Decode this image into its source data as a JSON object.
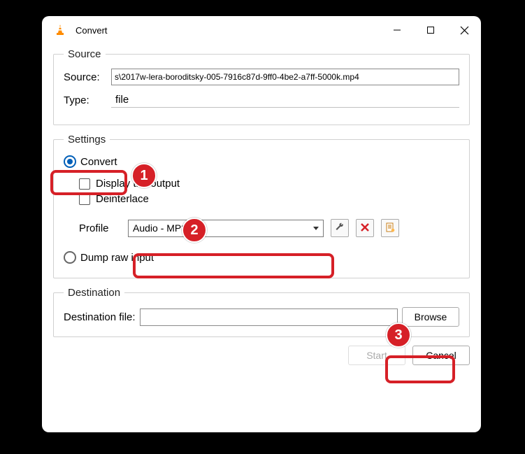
{
  "window": {
    "title": "Convert"
  },
  "source": {
    "legend": "Source",
    "source_label": "Source:",
    "source_value": "s\\2017w-lera-boroditsky-005-7916c87d-9ff0-4be2-a7ff-5000k.mp4",
    "type_label": "Type:",
    "type_value": "file"
  },
  "settings": {
    "legend": "Settings",
    "convert_label": "Convert",
    "display_output_label": "Display the output",
    "deinterlace_label": "Deinterlace",
    "profile_label": "Profile",
    "profile_value": "Audio - MP3",
    "dump_raw_label": "Dump raw input"
  },
  "destination": {
    "legend": "Destination",
    "label": "Destination file:",
    "value": "",
    "browse_label": "Browse"
  },
  "buttons": {
    "start": "Start",
    "cancel": "Cancel"
  },
  "annotations": {
    "n1": "1",
    "n2": "2",
    "n3": "3"
  }
}
